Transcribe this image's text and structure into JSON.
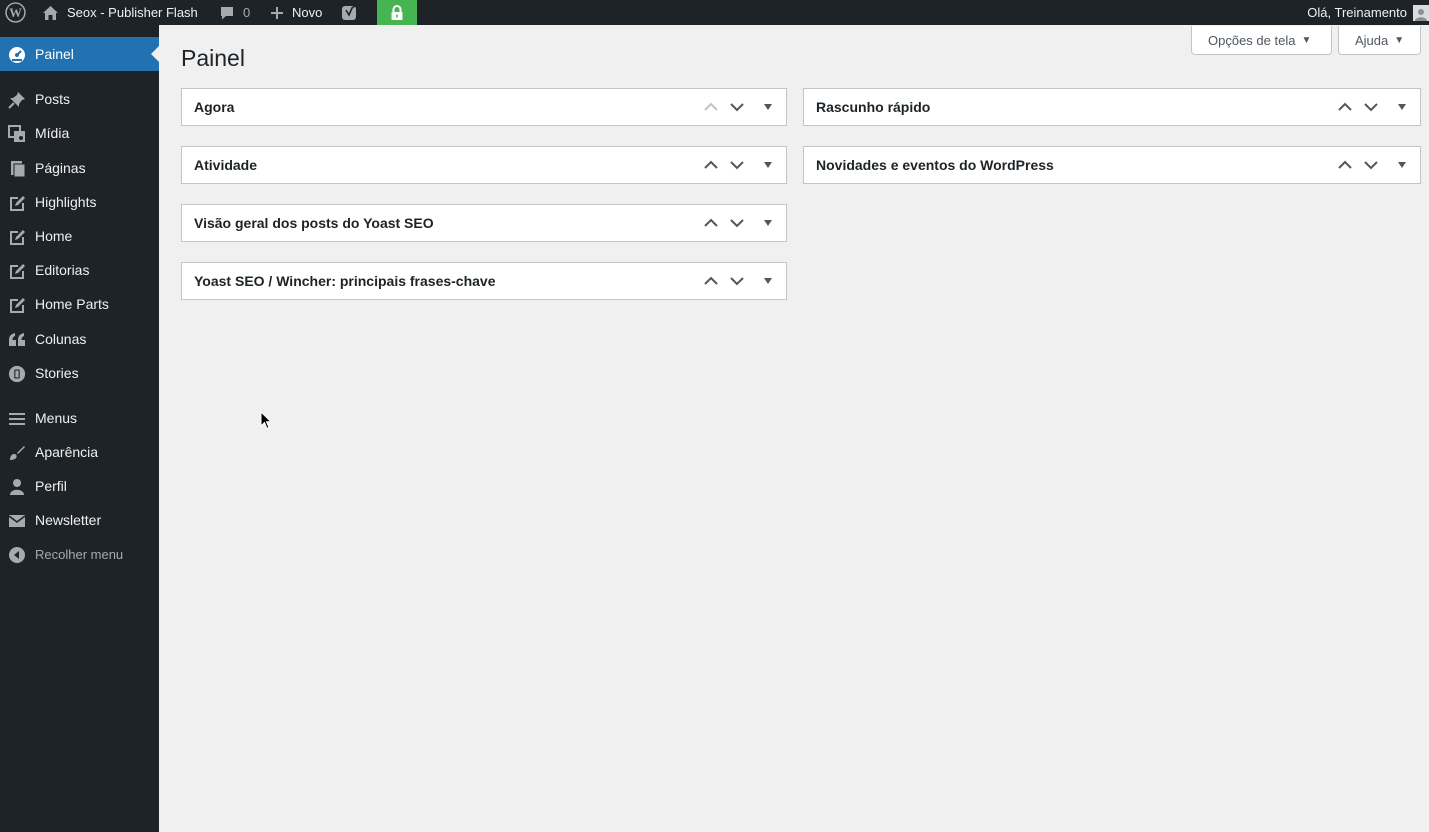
{
  "admin_bar": {
    "site_name": "Seox - Publisher Flash",
    "comments_count": "0",
    "new_label": "Novo",
    "greeting": "Olá, Treinamento",
    "lock_color": "#46b450"
  },
  "sidebar": {
    "items": [
      {
        "label": "Painel",
        "icon": "dashboard-icon",
        "current": true
      },
      {
        "label": "Posts",
        "icon": "pin-icon"
      },
      {
        "label": "Mídia",
        "icon": "media-icon"
      },
      {
        "label": "Páginas",
        "icon": "pages-icon"
      },
      {
        "label": "Highlights",
        "icon": "edit-page-icon"
      },
      {
        "label": "Home",
        "icon": "edit-page-icon"
      },
      {
        "label": "Editorias",
        "icon": "edit-page-icon"
      },
      {
        "label": "Home Parts",
        "icon": "edit-page-icon"
      },
      {
        "label": "Colunas",
        "icon": "quote-icon"
      },
      {
        "label": "Stories",
        "icon": "stories-icon"
      },
      {
        "label": "Menus",
        "icon": "menu-lines-icon"
      },
      {
        "label": "Aparência",
        "icon": "brush-icon"
      },
      {
        "label": "Perfil",
        "icon": "user-icon"
      },
      {
        "label": "Newsletter",
        "icon": "email-icon"
      }
    ],
    "collapse_label": "Recolher menu"
  },
  "main": {
    "screen_options_label": "Opções de tela",
    "help_label": "Ajuda",
    "page_title": "Painel",
    "widgets_left": [
      {
        "title": "Agora"
      },
      {
        "title": "Atividade"
      },
      {
        "title": "Visão geral dos posts do Yoast SEO"
      },
      {
        "title": "Yoast SEO / Wincher: principais frases-chave"
      }
    ],
    "widgets_right": [
      {
        "title": "Rascunho rápido"
      },
      {
        "title": "Novidades e eventos do WordPress"
      }
    ]
  },
  "colors": {
    "admin_bg": "#1d2327",
    "accent": "#2271b1",
    "page_bg": "#f0f0f1"
  }
}
